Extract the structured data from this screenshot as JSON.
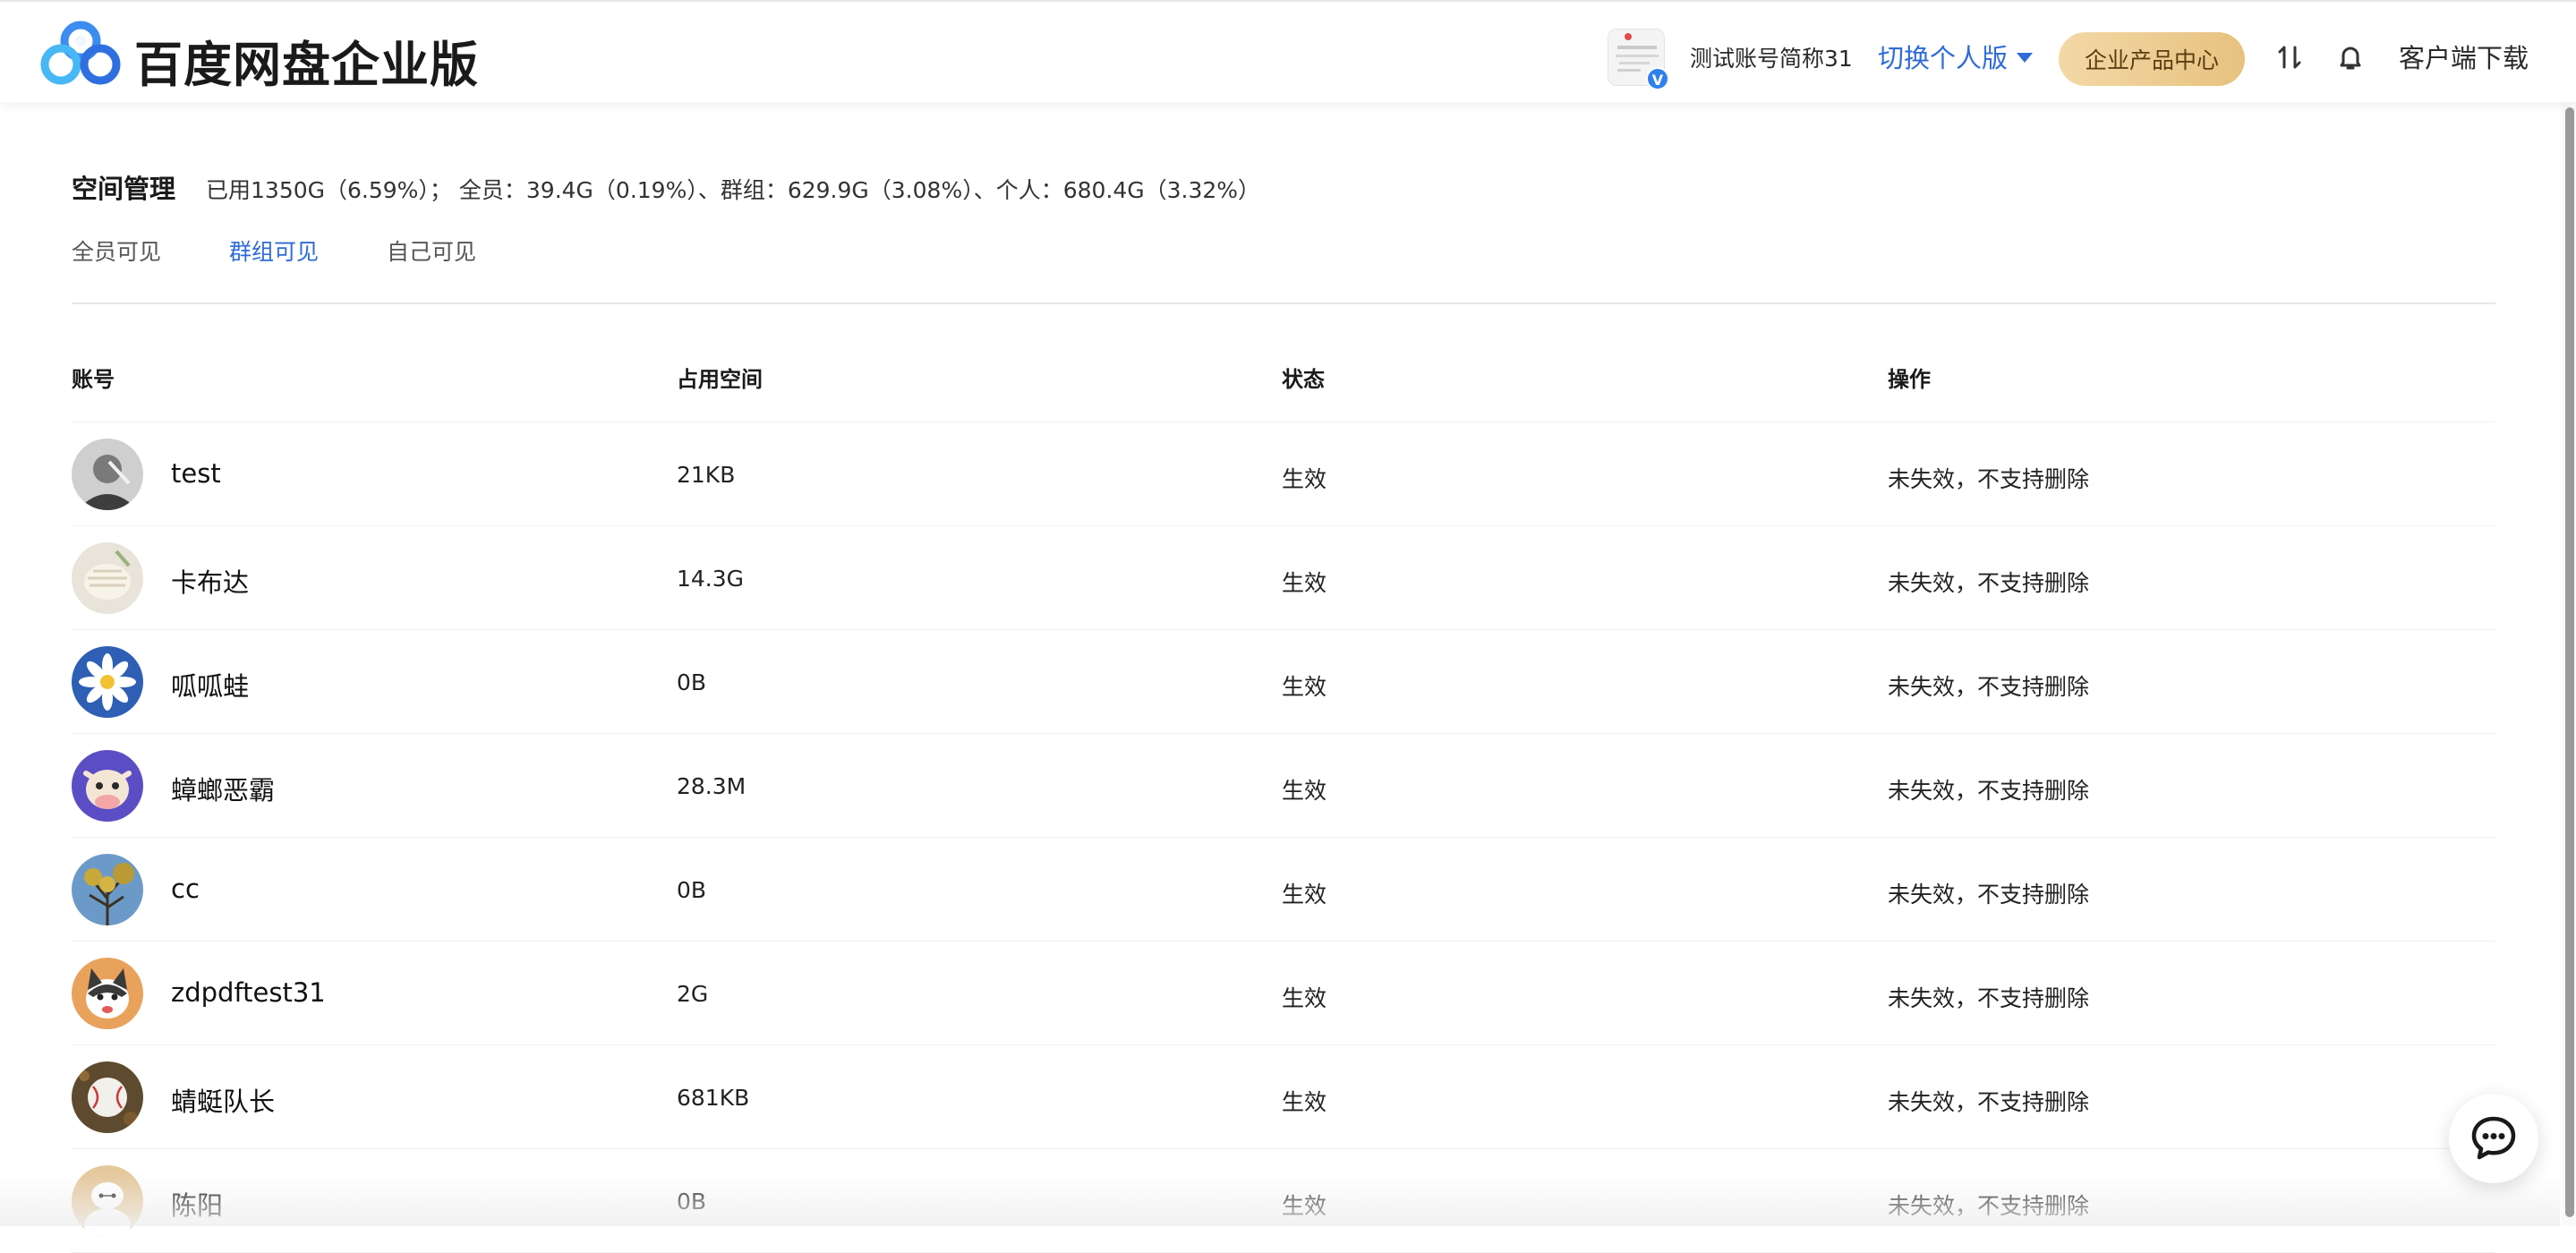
{
  "header": {
    "brand": "百度网盘企业版",
    "account_name": "测试账号简称31",
    "switch_label": "切换个人版",
    "product_center": "企业产品中心",
    "client_download": "客户端下载"
  },
  "space": {
    "title": "空间管理",
    "usage": "已用1350G（6.59%）； 全员：39.4G（0.19%）、群组：629.9G（3.08%）、个人：680.4G（3.32%）"
  },
  "tabs": [
    {
      "label": "全员可见",
      "active": false
    },
    {
      "label": "群组可见",
      "active": true
    },
    {
      "label": "自己可见",
      "active": false
    }
  ],
  "table": {
    "headers": {
      "account": "账号",
      "space": "占用空间",
      "status": "状态",
      "op": "操作"
    },
    "rows": [
      {
        "name": "test",
        "space": "21KB",
        "status": "生效",
        "op": "未失效，不支持删除",
        "avatar": "gray-sketch"
      },
      {
        "name": "卡布达",
        "space": "14.3G",
        "status": "生效",
        "op": "未失效，不支持删除",
        "avatar": "knit"
      },
      {
        "name": "呱呱蛙",
        "space": "0B",
        "status": "生效",
        "op": "未失效，不支持删除",
        "avatar": "daisy"
      },
      {
        "name": "蟑螂恶霸",
        "space": "28.3M",
        "status": "生效",
        "op": "未失效，不支持删除",
        "avatar": "cow"
      },
      {
        "name": "cc",
        "space": "0B",
        "status": "生效",
        "op": "未失效，不支持删除",
        "avatar": "tree"
      },
      {
        "name": "zdpdftest31",
        "space": "2G",
        "status": "生效",
        "op": "未失效，不支持删除",
        "avatar": "husky"
      },
      {
        "name": "蜻蜓队长",
        "space": "681KB",
        "status": "生效",
        "op": "未失效，不支持删除",
        "avatar": "ball"
      },
      {
        "name": "陈阳",
        "space": "0B",
        "status": "生效",
        "op": "未失效，不支持删除",
        "avatar": "baymax"
      }
    ]
  },
  "colors": {
    "accent": "#2f6bd8",
    "gold_start": "#f3d8a6",
    "gold_end": "#e7c27f"
  },
  "icons": [
    "baidu-netdisk-logo-icon",
    "transfer-icon",
    "bell-icon",
    "chat-icon",
    "verified-badge-icon"
  ]
}
